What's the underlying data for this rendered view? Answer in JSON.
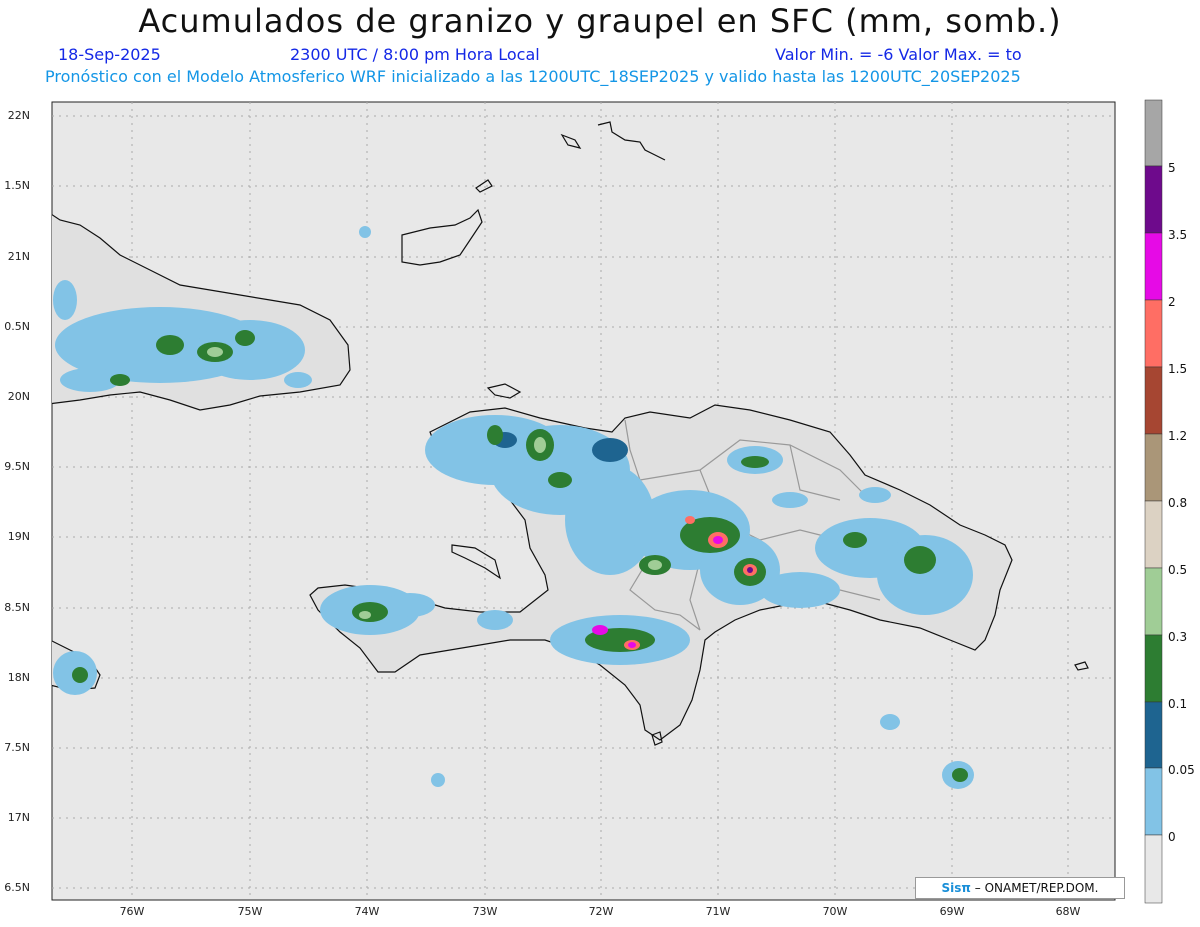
{
  "header": {
    "title": "Acumulados de granizo y graupel en SFC (mm, somb.)",
    "date": "18-Sep-2025",
    "time": "2300 UTC / 8:00 pm Hora Local",
    "minmax": "Valor Min. = -6  Valor Max. = to",
    "forecast": "Pronóstico con el Modelo Atmosferico WRF inicializado a las 1200UTC_18SEP2025 y valido hasta las  1200UTC_20SEP2025"
  },
  "axes": {
    "lat_ticks": [
      "22N",
      "1.5N",
      "21N",
      "0.5N",
      "20N",
      "9.5N",
      "19N",
      "8.5N",
      "18N",
      "7.5N",
      "17N",
      "6.5N"
    ],
    "lon_ticks": [
      "76W",
      "75W",
      "74W",
      "73W",
      "72W",
      "71W",
      "70W",
      "69W",
      "68W"
    ]
  },
  "colorbar": {
    "labels": [
      "5",
      "3.5",
      "2",
      "1.5",
      "1.2",
      "0.8",
      "0.5",
      "0.3",
      "0.1",
      "0.05",
      "0"
    ],
    "colors": [
      "#a6a6a6",
      "#6e0a8c",
      "#e60ae6",
      "#ff6e64",
      "#a64632",
      "#aa9678",
      "#dcd2c3",
      "#a0cd96",
      "#2d7d32",
      "#1e6490",
      "#82c3e6",
      "#e8e8e8"
    ]
  },
  "credit": {
    "logo": "Sisπ",
    "text": "– ONAMET/REP.DOM."
  },
  "colors": {
    "title_text": "#111111",
    "info_text": "#1428e6",
    "forecast_text": "#1496e6",
    "map_bg": "#e8e8e8"
  }
}
